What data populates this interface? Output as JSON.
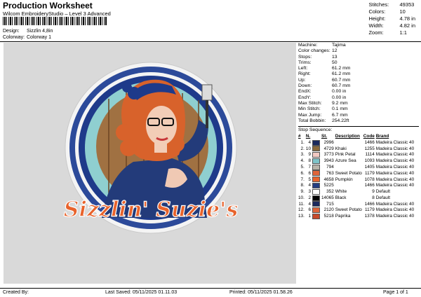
{
  "header": {
    "title": "Production Worksheet",
    "software": "Wilcom EmbroideryStudio – Level 3 Advanced",
    "design_label": "Design:",
    "design_value": "Sizzlin 4,8in",
    "colorway_label": "Colorway:",
    "colorway_value": "Colorway 1"
  },
  "stats": [
    {
      "k": "Stitches:",
      "v": "49353"
    },
    {
      "k": "Colors:",
      "v": "10"
    },
    {
      "k": "Height:",
      "v": "4.78 in"
    },
    {
      "k": "Width:",
      "v": "4.82 in"
    },
    {
      "k": "Zoom:",
      "v": "1:1"
    }
  ],
  "design": {
    "text": "Sizzlin' Suzie's"
  },
  "machine_info": [
    {
      "k": "Machine:",
      "v": "Tajima"
    },
    {
      "k": "Color changes:",
      "v": "12"
    },
    {
      "k": "Stops:",
      "v": "13"
    },
    {
      "k": "Trims:",
      "v": "50"
    },
    {
      "k": "Left:",
      "v": "61.2 mm"
    },
    {
      "k": "Right:",
      "v": "61.2 mm"
    },
    {
      "k": "Up:",
      "v": "60.7 mm"
    },
    {
      "k": "Down:",
      "v": "60.7 mm"
    },
    {
      "k": "EndX:",
      "v": "0.00 in"
    },
    {
      "k": "EndY:",
      "v": "0.00 in"
    },
    {
      "k": "Max Stitch:",
      "v": "9.2 mm"
    },
    {
      "k": "Min Stitch:",
      "v": "0.1 mm"
    },
    {
      "k": "Max Jump:",
      "v": "6.7 mm"
    },
    {
      "k": "Total Bobbin:",
      "v": "254.22ft"
    }
  ],
  "sequence": {
    "label": "Stop Sequence:",
    "columns": [
      "#",
      "N.",
      "St.",
      "Description",
      "Code",
      "Brand"
    ],
    "rows": [
      {
        "idx": "1.",
        "n": "4",
        "color": "#1b2a5e",
        "st": "2996",
        "desc": "",
        "code": "1466",
        "brand": "Madeira Classic 40"
      },
      {
        "idx": "2.",
        "n": "10",
        "color": "#8a6a3c",
        "st": "4729",
        "desc": "Khaki",
        "code": "1255",
        "brand": "Madeira Classic 40"
      },
      {
        "idx": "3.",
        "n": "9",
        "color": "#f3c9c2",
        "st": "3773",
        "desc": "Pink Petal",
        "code": "1114",
        "brand": "Madeira Classic 40"
      },
      {
        "idx": "4.",
        "n": "8",
        "color": "#7fc4c9",
        "st": "3943",
        "desc": "Azure Sea",
        "code": "1093",
        "brand": "Madeira Classic 40"
      },
      {
        "idx": "5.",
        "n": "7",
        "color": "#b9b4aa",
        "st": "794",
        "desc": "",
        "code": "1405",
        "brand": "Madeira Classic 40"
      },
      {
        "idx": "6.",
        "n": "6",
        "color": "#e0653a",
        "st": "763",
        "desc": "Sweet Potato",
        "code": "1179",
        "brand": "Madeira Classic 40"
      },
      {
        "idx": "7.",
        "n": "5",
        "color": "#e8632c",
        "st": "4658",
        "desc": "Pumpkin",
        "code": "1078",
        "brand": "Madeira Classic 40"
      },
      {
        "idx": "8.",
        "n": "4",
        "color": "#243d80",
        "st": "5225",
        "desc": "",
        "code": "1466",
        "brand": "Madeira Classic 40"
      },
      {
        "idx": "9.",
        "n": "3",
        "color": "#ffffff",
        "st": "352",
        "desc": "White",
        "code": "9",
        "brand": "Default"
      },
      {
        "idx": "10.",
        "n": "2",
        "color": "#000000",
        "st": "14065",
        "desc": "Black",
        "code": "8",
        "brand": "Default"
      },
      {
        "idx": "11.",
        "n": "4",
        "color": "#1b2a5e",
        "st": "715",
        "desc": "",
        "code": "1466",
        "brand": "Madeira Classic 40"
      },
      {
        "idx": "12.",
        "n": "6",
        "color": "#e0653a",
        "st": "2120",
        "desc": "Sweet Potato",
        "code": "1179",
        "brand": "Madeira Classic 40"
      },
      {
        "idx": "13.",
        "n": "1",
        "color": "#c84a2a",
        "st": "5218",
        "desc": "Paprika",
        "code": "1378",
        "brand": "Madeira Classic 40"
      }
    ]
  },
  "footer": {
    "created_by": "Created By:",
    "last_saved": "Last Saved: 05/11/2025 01.11.03",
    "printed": "Printed: 05/11/2025 01.58.26",
    "page": "Page 1 of 1"
  }
}
